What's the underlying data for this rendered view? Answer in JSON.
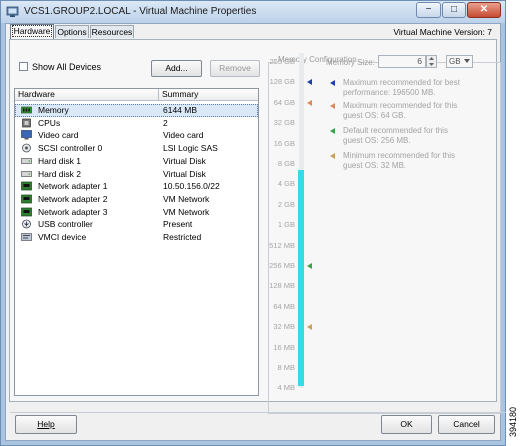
{
  "window": {
    "title": "VCS1.GROUP2.LOCAL - Virtual Machine Properties",
    "controls": {
      "minimize": "−",
      "maximize": "□",
      "close": "✕"
    }
  },
  "tabs": [
    {
      "label": "Hardware",
      "active": true
    },
    {
      "label": "Options",
      "active": false
    },
    {
      "label": "Resources",
      "active": false
    }
  ],
  "vm_version": "Virtual Machine Version: 7",
  "hardware": {
    "show_all_devices_label": "Show All Devices",
    "show_all_devices_checked": false,
    "add_button": "Add...",
    "remove_button": "Remove",
    "columns": [
      "Hardware",
      "Summary"
    ],
    "rows": [
      {
        "icon": "memory-icon",
        "name": "Memory",
        "summary": "6144 MB",
        "selected": true
      },
      {
        "icon": "cpu-icon",
        "name": "CPUs",
        "summary": "2"
      },
      {
        "icon": "video-card-icon",
        "name": "Video card",
        "summary": "Video card"
      },
      {
        "icon": "scsi-controller-icon",
        "name": "SCSI controller 0",
        "summary": "LSI Logic SAS"
      },
      {
        "icon": "hard-disk-icon",
        "name": "Hard disk 1",
        "summary": "Virtual Disk"
      },
      {
        "icon": "hard-disk-icon",
        "name": "Hard disk 2",
        "summary": "Virtual Disk"
      },
      {
        "icon": "network-adapter-icon",
        "name": "Network adapter 1",
        "summary": "10.50.156.0/22"
      },
      {
        "icon": "network-adapter-icon",
        "name": "Network adapter 2",
        "summary": "VM Network"
      },
      {
        "icon": "network-adapter-icon",
        "name": "Network adapter 3",
        "summary": "VM Network"
      },
      {
        "icon": "usb-controller-icon",
        "name": "USB controller",
        "summary": "Present"
      },
      {
        "icon": "vmci-device-icon",
        "name": "VMCI device",
        "summary": "Restricted"
      }
    ]
  },
  "memory_config": {
    "legend": "Memory Configuration",
    "memory_size_label": "Memory Size:",
    "memory_size_value": "6",
    "unit": "GB",
    "scale_labels": [
      "255 GB",
      "128 GB",
      "64 GB",
      "32 GB",
      "16 GB",
      "8 GB",
      "4 GB",
      "2 GB",
      "1 GB",
      "512 MB",
      "256 MB",
      "128 MB",
      "64 MB",
      "32 MB",
      "16 MB",
      "8 MB",
      "4 MB"
    ],
    "current_value_mb": 6144,
    "legend_items": [
      {
        "color": "#1e3fa8",
        "text": "Maximum recommended for best performance: 196500 MB."
      },
      {
        "color": "#d98a5a",
        "text": "Maximum recommended for this guest OS: 64 GB."
      },
      {
        "color": "#3aa34a",
        "text": "Default recommended for this guest OS: 256 MB."
      },
      {
        "color": "#c9a060",
        "text": "Minimum recommended for this guest OS: 32 MB."
      }
    ],
    "markers": [
      {
        "label_index": 1,
        "color": "#1e3fa8"
      },
      {
        "label_index": 2,
        "color": "#d98a5a"
      },
      {
        "label_index": 10,
        "color": "#3aa34a"
      },
      {
        "label_index": 13,
        "color": "#c9a060"
      }
    ]
  },
  "footer": {
    "help_button": "Help",
    "ok_button": "OK",
    "cancel_button": "Cancel"
  },
  "side_code": "394180"
}
